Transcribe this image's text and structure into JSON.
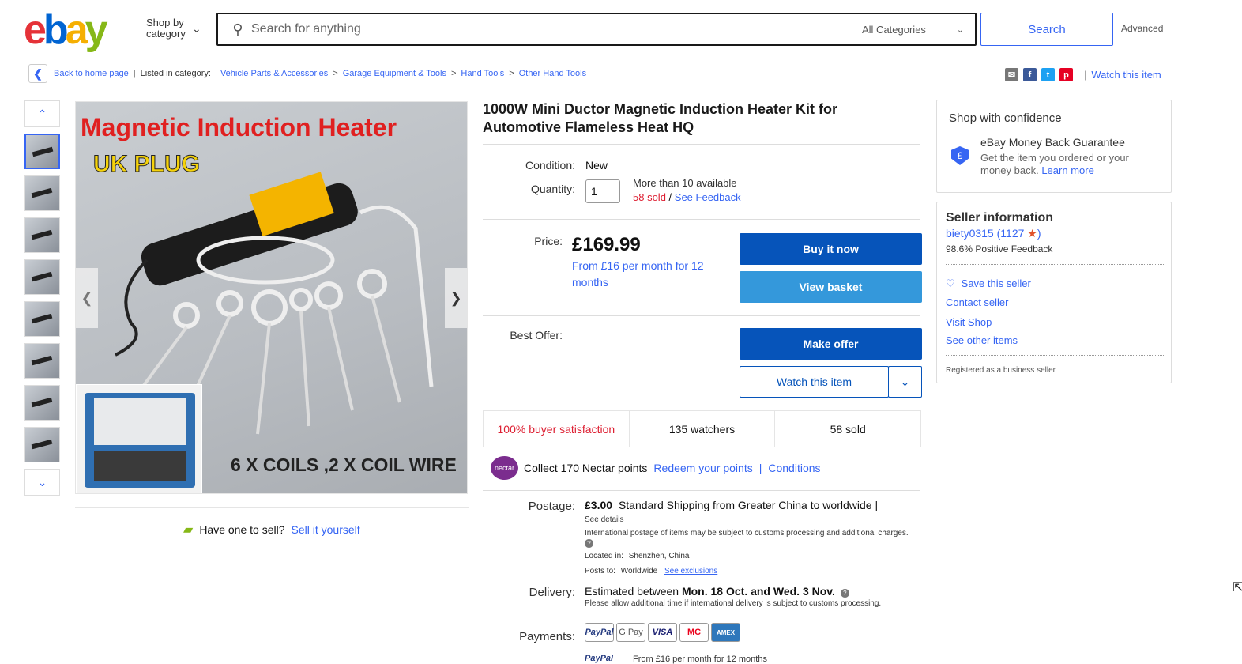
{
  "header": {
    "logo": [
      "e",
      "b",
      "a",
      "y"
    ],
    "shop_by_line1": "Shop by",
    "shop_by_line2": "category",
    "search_placeholder": "Search for anything",
    "category": "All Categories",
    "search_button": "Search",
    "advanced": "Advanced"
  },
  "breadcrumb": {
    "back": "Back to home page",
    "listed": "Listed in category:",
    "items": [
      "Vehicle Parts & Accessories",
      "Garage Equipment & Tools",
      "Hand Tools",
      "Other Hand Tools"
    ],
    "watch": "Watch this item"
  },
  "image": {
    "title_text": "Magnetic Induction Heater",
    "plug_text": "UK PLUG",
    "coils_text": "6 X COILS ,2 X COIL WIRE"
  },
  "sell": {
    "prompt": "Have one to sell?",
    "link": "Sell it yourself"
  },
  "listing": {
    "title": "1000W Mini Ductor Magnetic Induction Heater Kit for Automotive Flameless Heat HQ",
    "condition_label": "Condition:",
    "condition": "New",
    "quantity_label": "Quantity:",
    "quantity": "1",
    "available": "More than 10 available",
    "sold_link": "58 sold",
    "feedback_link": "See Feedback",
    "price_label": "Price:",
    "price": "£169.99",
    "monthly": "From £16 per month for 12 months",
    "buy_now": "Buy it now",
    "view_basket": "View basket",
    "best_offer_label": "Best Offer:",
    "make_offer": "Make offer",
    "watch_item": "Watch this item",
    "stats": [
      "100% buyer satisfaction",
      "135 watchers",
      "58 sold"
    ],
    "nectar_logo": "nectar",
    "nectar_text": "Collect 170 Nectar points",
    "redeem": "Redeem your points",
    "conditions": "Conditions",
    "postage_label": "Postage:",
    "postage_price": "£3.00",
    "postage_desc": "Standard Shipping from Greater China to worldwide |",
    "see_details": "See details",
    "intl_note": "International postage of items may be subject to customs processing and additional charges.",
    "located_label": "Located in:",
    "located": "Shenzhen, China",
    "posts_label": "Posts to:",
    "posts": "Worldwide",
    "exclusions": "See exclusions",
    "delivery_label": "Delivery:",
    "delivery_prefix": "Estimated between",
    "delivery_dates": "Mon. 18 Oct. and Wed. 3 Nov.",
    "delivery_note": "Please allow additional time if international delivery is subject to customs processing.",
    "payments_label": "Payments:",
    "payments": [
      "PayPal",
      "G Pay",
      "VISA",
      "MC",
      "AMEX"
    ],
    "paypal_credit": "From £16 per month for 12 months"
  },
  "confidence": {
    "title": "Shop with confidence",
    "guarantee_title": "eBay Money Back Guarantee",
    "guarantee_text": "Get the item you ordered or your money back.",
    "learn_more": "Learn more"
  },
  "seller": {
    "title": "Seller information",
    "name": "biety0315",
    "score": "1127",
    "positive": "98.6% Positive Feedback",
    "save": "Save this seller",
    "contact": "Contact seller",
    "visit": "Visit Shop",
    "other": "See other items",
    "registered": "Registered as a business seller"
  },
  "colors": {
    "accent": "#3665f3",
    "buy": "#0654ba",
    "basket": "#3498db",
    "alert": "#dd1e31"
  }
}
